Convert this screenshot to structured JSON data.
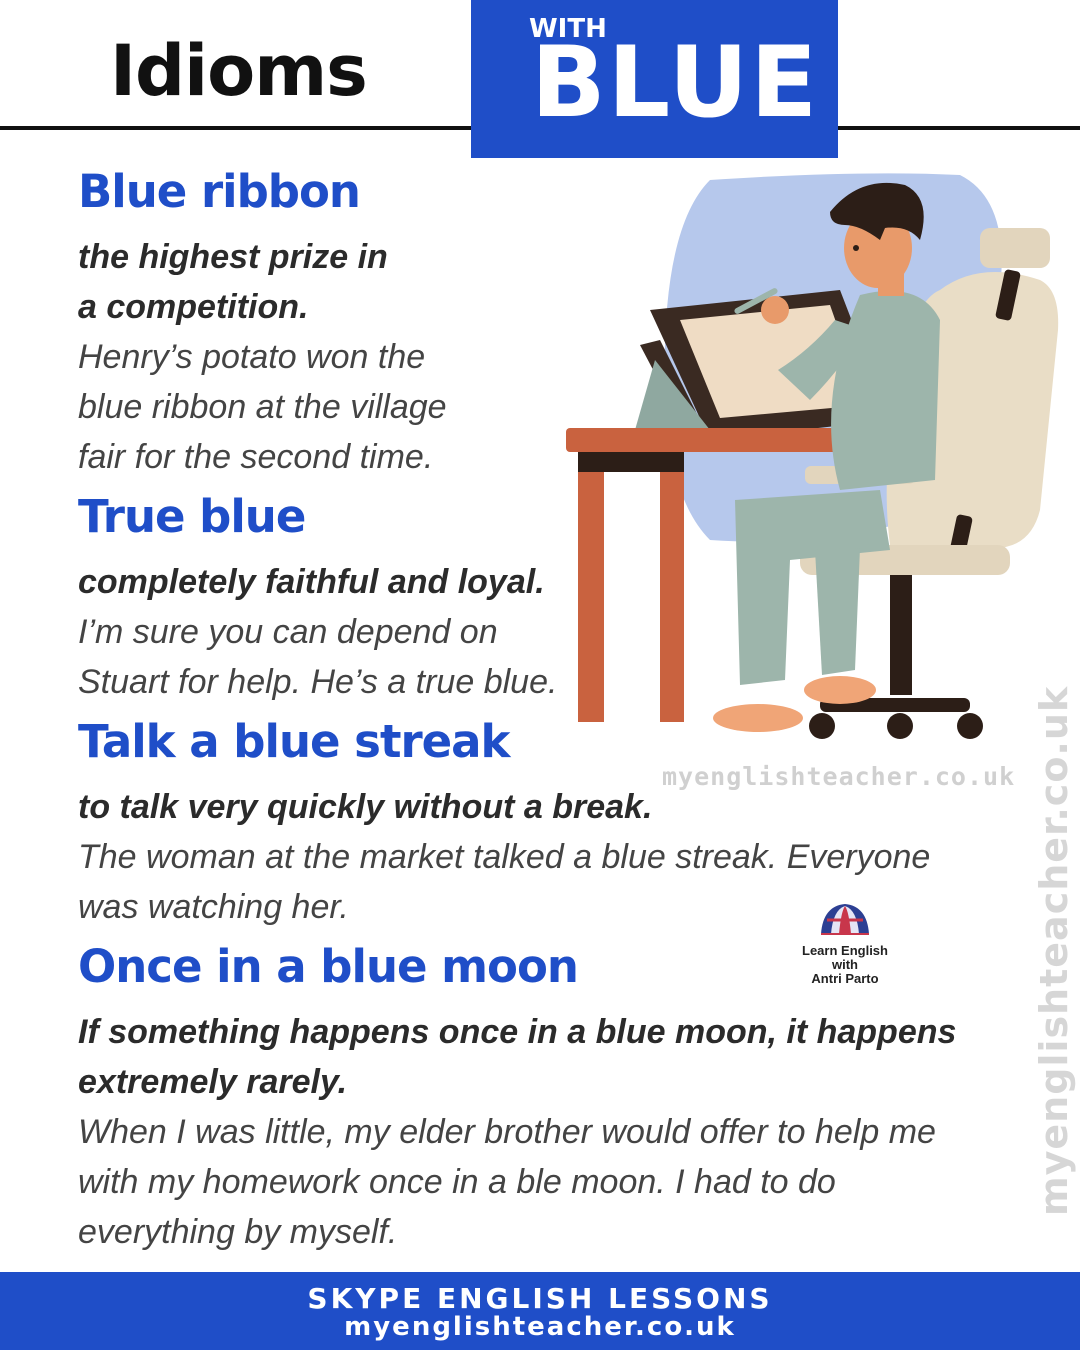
{
  "header": {
    "title": "Idioms",
    "with_label": "WITH",
    "blue_label": "BLUE"
  },
  "idioms": [
    {
      "heading": "Blue ribbon",
      "definition_lines": [
        "the highest prize in",
        "a competition."
      ],
      "example_lines": [
        "Henry’s potato won the",
        "blue ribbon at the village",
        "fair for the second time."
      ]
    },
    {
      "heading": "True blue",
      "definition_lines": [
        "completely faithful and loyal."
      ],
      "example_lines": [
        "I’m sure you can depend on",
        "Stuart for help. He’s a true blue."
      ]
    },
    {
      "heading": "Talk a blue streak",
      "definition_lines": [
        "to talk very quickly without a break."
      ],
      "example_lines": [
        "The woman at the market talked a blue streak. Everyone",
        "was watching her."
      ]
    },
    {
      "heading": "Once in a blue moon",
      "definition_lines": [
        "If something happens once in a blue moon, it happens",
        "extremely rarely."
      ],
      "example_lines": [
        "When I was little, my elder brother would offer to help me",
        "with my homework once in a ble moon. I had to do",
        "everything by myself."
      ]
    }
  ],
  "watermark": {
    "horizontal": "myenglishteacher.co.uk",
    "vertical": "myenglishteacher.co.uk"
  },
  "logo": {
    "line1": "Learn English",
    "line2": "with",
    "line3": "Antri Parto"
  },
  "footer": {
    "line1": "SKYPE ENGLISH LESSONS",
    "line2": "myenglishteacher.co.uk"
  },
  "colors": {
    "accent_blue": "#1f4ec8",
    "text_dark": "#2b2b2b"
  }
}
